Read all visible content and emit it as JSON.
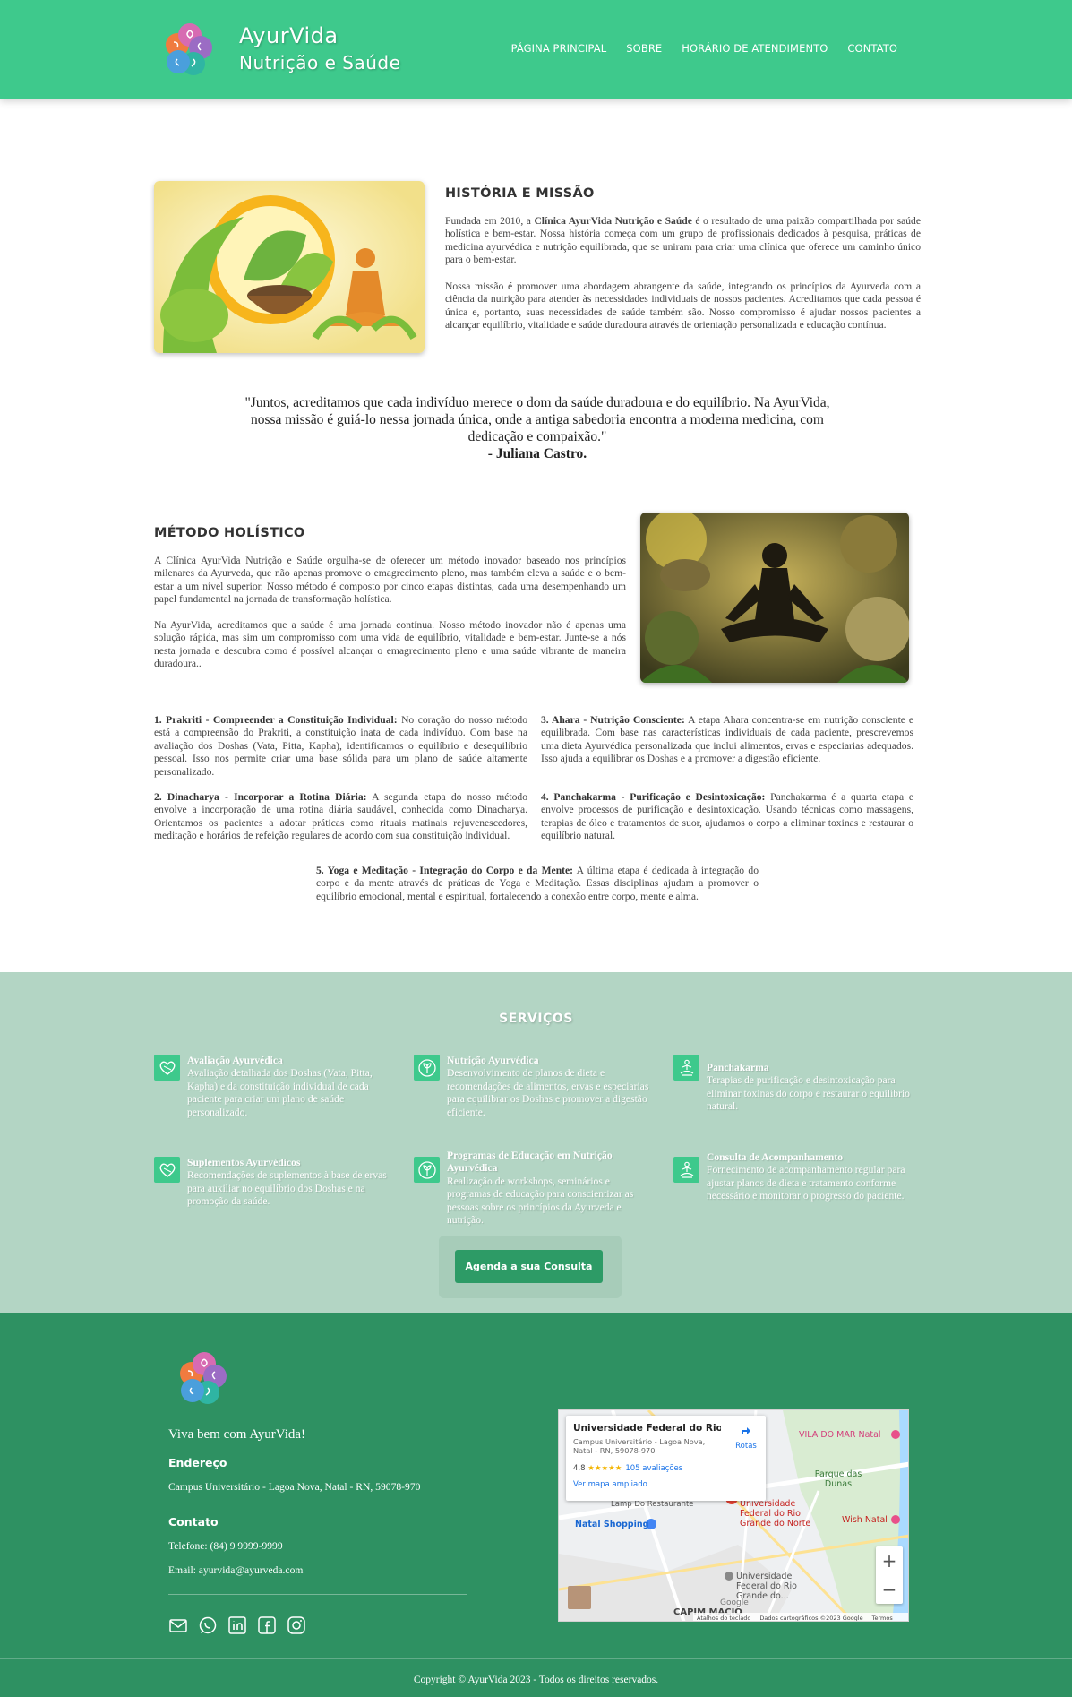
{
  "header": {
    "brand_line1": "AyurVida",
    "brand_line2": "Nutrição e Saúde",
    "nav": [
      "PÁGINA PRINCIPAL",
      "SOBRE",
      "HORÁRIO DE ATENDIMENTO",
      "CONTATO"
    ]
  },
  "history": {
    "title": "HISTÓRIA E MISSÃO",
    "p1_pre": "Fundada em 2010, a ",
    "p1_bold": "Clínica AyurVida Nutrição e Saúde",
    "p1_post": " é o resultado de uma paixão compartilhada por saúde holística e bem-estar. Nossa história começa com um grupo de profissionais dedicados à pesquisa, práticas de medicina ayurvédica e nutrição equilibrada, que se uniram para criar uma clínica que oferece um caminho único para o bem-estar.",
    "p2": "Nossa missão é promover uma abordagem abrangente da saúde, integrando os princípios da Ayurveda com a ciência da nutrição para atender às necessidades individuais de nossos pacientes. Acreditamos que cada pessoa é única e, portanto, suas necessidades de saúde também são. Nosso compromisso é ajudar nossos pacientes a alcançar equilíbrio, vitalidade e saúde duradoura através de orientação personalizada e educação contínua."
  },
  "quote": {
    "text": "\"Juntos, acreditamos que cada indivíduo merece o dom da saúde duradoura e do equilíbrio. Na AyurVida, nossa missão é guiá-lo nessa jornada única, onde a antiga sabedoria encontra a moderna medicina, com dedicação e compaixão.\"",
    "author": "- Juliana Castro."
  },
  "method": {
    "title": "MÉTODO HOLÍSTICO",
    "p1": "A Clínica AyurVida Nutrição e Saúde orgulha-se de oferecer um método inovador baseado nos princípios milenares da Ayurveda, que não apenas promove o emagrecimento pleno, mas também eleva a saúde e o bem-estar a um nível superior. Nosso método é composto por cinco etapas distintas, cada uma desempenhando um papel fundamental na jornada de transformação holística.",
    "p2": "Na AyurVida, acreditamos que a saúde é uma jornada contínua. Nosso método inovador não é apenas uma solução rápida, mas sim um compromisso com uma vida de equilíbrio, vitalidade e bem-estar. Junte-se a nós nesta jornada e descubra como é possível alcançar o emagrecimento pleno e uma saúde vibrante de maneira duradoura..",
    "steps": [
      {
        "head": "1. Prakriti - Compreender a Constituição Individual:",
        "body": " No coração do nosso método está a compreensão do Prakriti, a constituição inata de cada indivíduo. Com base na avaliação dos Doshas (Vata, Pitta, Kapha), identificamos o equilíbrio e desequilíbrio pessoal. Isso nos permite criar uma base sólida para um plano de saúde altamente personalizado."
      },
      {
        "head": "2. Dinacharya - Incorporar a Rotina Diária:",
        "body": " A segunda etapa do nosso método envolve a incorporação de uma rotina diária saudável, conhecida como Dinacharya. Orientamos os pacientes a adotar práticas como rituais matinais rejuvenescedores, meditação e horários de refeição regulares de acordo com sua constituição individual."
      },
      {
        "head": "3. Ahara - Nutrição Consciente:",
        "body": " A etapa Ahara concentra-se em nutrição consciente e equilibrada. Com base nas características individuais de cada paciente, prescrevemos uma dieta Ayurvédica personalizada que inclui alimentos, ervas e especiarias adequados. Isso ajuda a equilibrar os Doshas e a promover a digestão eficiente."
      },
      {
        "head": "4. Panchakarma - Purificação e Desintoxicação:",
        "body": " Panchakarma é a quarta etapa e envolve processos de purificação e desintoxicação. Usando técnicas como massagens, terapias de óleo e tratamentos de suor, ajudamos o corpo a eliminar toxinas e restaurar o equilíbrio natural."
      },
      {
        "head": "5. Yoga e Meditação - Integração do Corpo e da Mente:",
        "body": " A última etapa é dedicada à integração do corpo e da mente através de práticas de Yoga e Meditação. Essas disciplinas ajudam a promover o equilíbrio emocional, mental e espiritual, fortalecendo a conexão entre corpo, mente e alma."
      }
    ]
  },
  "services": {
    "title": "SERVIÇOS",
    "items": [
      {
        "name": "Avaliação Ayurvédica",
        "desc": "Avaliação detalhada dos Doshas (Vata, Pitta, Kapha) e da constituição individual de cada paciente para criar um plano de saúde personalizado.",
        "icon": "leaf-heart-icon"
      },
      {
        "name": "Nutrição Ayurvédica",
        "desc": "Desenvolvimento de planos de dieta e recomendações de alimentos, ervas e especiarias para equilibrar os Doshas e promover a digestão eficiente.",
        "icon": "sprout-icon"
      },
      {
        "name": "Panchakarma",
        "desc": "Terapias de purificação e desintoxicação para eliminar toxinas do corpo e restaurar o equilíbrio natural.",
        "icon": "meditation-icon"
      },
      {
        "name": "Suplementos Ayurvédicos",
        "desc": "Recomendações de suplementos à base de ervas para auxiliar no equilíbrio dos Doshas e na promoção da saúde.",
        "icon": "leaf-heart-icon"
      },
      {
        "name": "Programas de Educação em Nutrição Ayurvédica",
        "desc": "Realização de workshops, seminários e programas de educação para conscientizar as pessoas sobre os princípios da Ayurveda e nutrição.",
        "icon": "sprout-icon"
      },
      {
        "name": "Consulta de Acompanhamento",
        "desc": "Fornecimento de acompanhamento regular para ajustar planos de dieta e tratamento conforme necessário e monitorar o progresso do paciente.",
        "icon": "meditation-icon"
      }
    ],
    "cta": "Agenda a sua Consulta"
  },
  "footer": {
    "tagline": "Viva bem com AyurVida!",
    "address_title": "Endereço",
    "address": "Campus Universitário - Lagoa Nova, Natal - RN, 59078-970",
    "contact_title": "Contato",
    "phone": "Telefone: (84) 9 9999-9999",
    "email": "Email: ayurvida@ayurveda.com",
    "social_icons": [
      "email-icon",
      "whatsapp-icon",
      "linkedin-icon",
      "facebook-icon",
      "instagram-icon"
    ],
    "copyright": "Copyright © AyurVida 2023 - Todos os direitos reservados."
  },
  "map": {
    "place": "Universidade Federal do Rio G...",
    "address": "Campus Universitário - Lagoa Nova, Natal - RN, 59078-970",
    "rating": "4,8",
    "stars": "★★★★★",
    "reviews": "105 avaliações",
    "directions": "Rotas",
    "enlarge": "Ver mapa ampliado",
    "labels": {
      "vila_do_mar": "VILA DO MAR Natal",
      "parque": "Parque das Dunas",
      "ufrn": "Universidade Federal do Rio Grande do Norte",
      "wish": "Wish Natal",
      "shopping": "Natal Shopping",
      "ufrn2": "Universidade Federal do Rio Grande do...",
      "capim": "CAPIM MACIO",
      "google": "Google",
      "restaurant": "Lamp Do Restaurante"
    },
    "zoom_in": "+",
    "zoom_out": "−",
    "attribution": [
      "Atalhos do teclado",
      "Dados cartográficos ©2023 Google",
      "Termos"
    ]
  },
  "colors": {
    "header": "#3ec98c",
    "services_bg": "#b3d5c4",
    "footer_bg": "#2e9162",
    "button": "#2d9b66"
  }
}
